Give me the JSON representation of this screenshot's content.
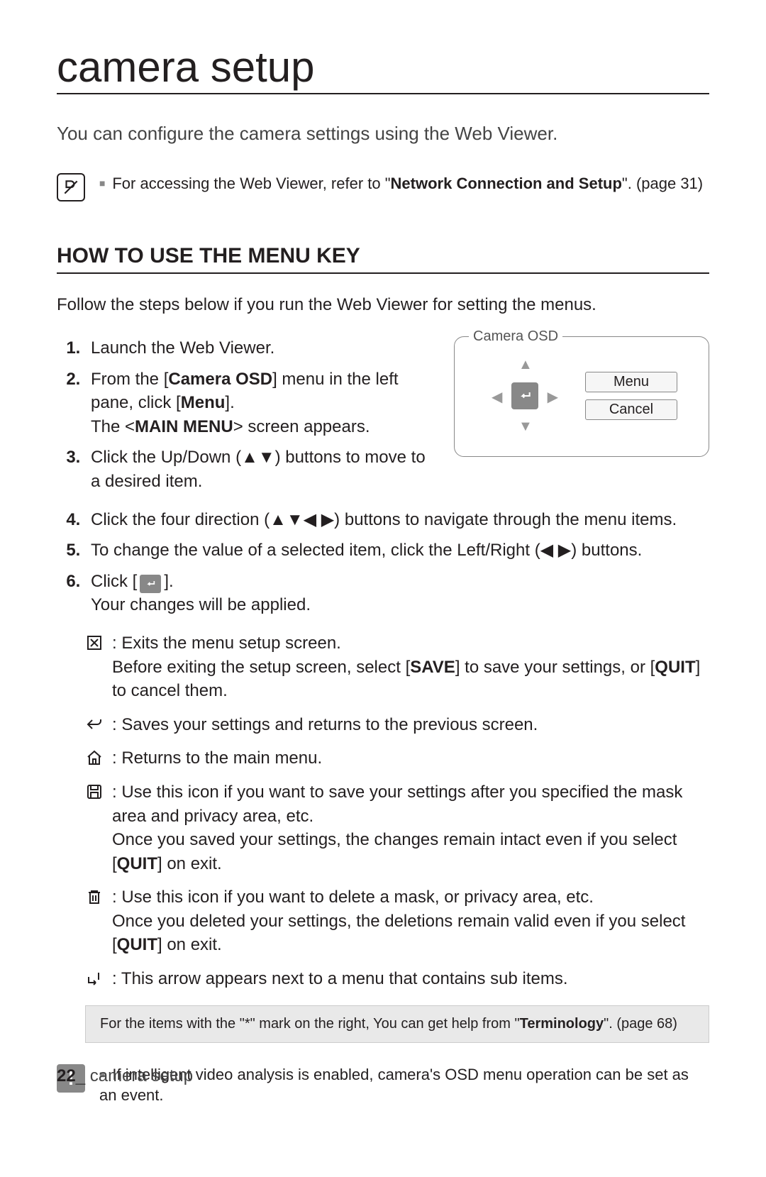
{
  "page_title": "camera setup",
  "intro": "You can configure the camera settings using the Web Viewer.",
  "top_note": {
    "prefix": "For accessing the Web Viewer, refer to \"",
    "bold": "Network Connection and Setup",
    "suffix": "\". (page 31)"
  },
  "section_heading": "HOW TO USE THE MENU KEY",
  "section_intro": "Follow the steps below if you run the Web Viewer for setting the menus.",
  "steps": {
    "s1": "Launch the Web Viewer.",
    "s2_a": "From the [",
    "s2_b": "Camera OSD",
    "s2_c": "] menu in the left pane, click [",
    "s2_d": "Menu",
    "s2_e": "].",
    "s2_sub_a": "The <",
    "s2_sub_b": "MAIN MENU",
    "s2_sub_c": "> screen appears.",
    "s3": "Click the Up/Down (▲▼) buttons to move to a desired item.",
    "s4": "Click the four direction (▲▼◀ ▶) buttons to navigate through the menu items.",
    "s5": "To change the value of a selected item, click the Left/Right (◀ ▶) buttons.",
    "s6_a": "Click [",
    "s6_b": "].",
    "s6_sub": "Your changes will be applied."
  },
  "osd": {
    "legend": "Camera OSD",
    "menu_btn": "Menu",
    "cancel_btn": "Cancel"
  },
  "icons": {
    "exit_a": ": Exits the menu setup screen.",
    "exit_b1": "Before exiting the setup screen, select [",
    "exit_b2": "SAVE",
    "exit_b3": "] to save your settings, or [",
    "exit_b4": "QUIT",
    "exit_b5": "] to cancel them.",
    "back": ": Saves your settings and returns to the previous screen.",
    "home": ": Returns to the main menu.",
    "save_a": ": Use this icon if you want to save your settings after you specified the mask area and privacy area, etc.",
    "save_b1": "Once you saved your settings, the changes remain intact even if you select [",
    "save_b2": "QUIT",
    "save_b3": "] on exit.",
    "del_a": ": Use this icon if you want to delete a mask, or privacy area, etc.",
    "del_b1": "Once you deleted your settings, the deletions remain valid even if you select [",
    "del_b2": "QUIT",
    "del_b3": "] on exit.",
    "sub": ": This arrow appears next to a menu that contains sub items."
  },
  "help_prefix": "For the items with the \"*\" mark on the right, You can get help from \"",
  "help_bold": "Terminology",
  "help_suffix": "\". (page 68)",
  "bottom_note": "If intelligent video analysis is enabled, camera's OSD menu operation can be set as an event.",
  "footer": {
    "page_no": "22",
    "sep": "_ ",
    "label": "camera setup"
  }
}
